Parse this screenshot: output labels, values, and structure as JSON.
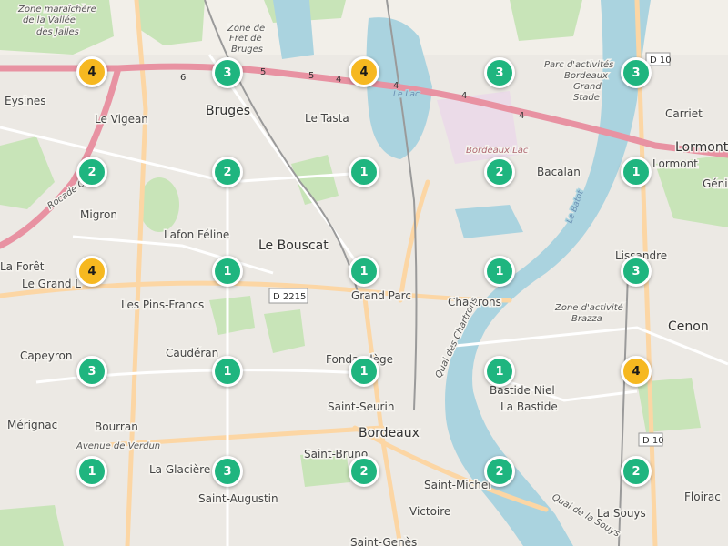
{
  "map": {
    "labels": {
      "zone_maraichere_1": "Zone maraîchère",
      "zone_maraichere_2": "de la Vallée",
      "zone_maraichere_3": "des Jalles",
      "zone_fret_1": "Zone de",
      "zone_fret_2": "Fret de",
      "zone_fret_3": "Bruges",
      "parc_1": "Parc d'activités",
      "parc_2": "Bordeaux",
      "parc_3": "Grand",
      "parc_4": "Stade",
      "eysines": "Eysines",
      "le_vigean": "Le Vigean",
      "bruges": "Bruges",
      "le_tasta": "Le Tasta",
      "le_lac": "Le Lac",
      "bordeaux_lac": "Bordeaux Lac",
      "carriet": "Carriet",
      "lormont_1": "Lormont",
      "lormont_2": "Lormont",
      "genic": "Génic",
      "bacalan": "Bacalan",
      "migron": "Migron",
      "lafon_feline": "Lafon Féline",
      "le_bouscat": "Le Bouscat",
      "la_foret": "La Forêt",
      "le_grand_lac": "Le Grand L",
      "les_pins_francs": "Les Pins-Francs",
      "grand_parc": "Grand Parc",
      "chartrons": "Chartrons",
      "lissandre": "Lissandre",
      "zone_brazza_1": "Zone d'activité",
      "zone_brazza_2": "Brazza",
      "cenon": "Cenon",
      "capeyron": "Capeyron",
      "cauderan": "Caudéran",
      "fondaudege": "Fondaudège",
      "bastide_niel": "Bastide Niel",
      "la_bastide": "La Bastide",
      "saint_seurin": "Saint-Seurin",
      "bordeaux": "Bordeaux",
      "merignac": "Mérignac",
      "bourran": "Bourran",
      "avenue_verdun": "Avenue de Verdun",
      "la_glaciere": "La Glacière",
      "saint_bruno": "Saint-Bruno",
      "saint_michel": "Saint-Michel",
      "saint_augustin": "Saint-Augustin",
      "victoire": "Victoire",
      "la_souys": "La Souys",
      "floirac": "Floirac",
      "saint_genes": "Saint-Genès",
      "quai_chartrons": "Quai des Chartrons",
      "quai_souys": "Quai de la Souys",
      "rocade": "Rocade Ouest",
      "le_batot": "Le Batot"
    },
    "shields": {
      "d2215": "D 2215",
      "d10_top": "D 10",
      "d10_bottom": "D 10",
      "r4a": "4",
      "r4b": "4",
      "r4c": "4",
      "r4d": "4",
      "r5": "5",
      "r6": "6",
      "r5b": "5"
    },
    "colors": {
      "land": "#f2efe9",
      "water": "#aad3df",
      "park": "#c8e4b8",
      "motorway": "#e892a2",
      "primary_road": "#fcd6a4",
      "cluster_small": "#1fb57f",
      "cluster_medium": "#f6b820"
    }
  },
  "clusters": [
    {
      "id": "c1",
      "count": "4",
      "level": "yellow"
    },
    {
      "id": "c2",
      "count": "3",
      "level": "green"
    },
    {
      "id": "c3",
      "count": "4",
      "level": "yellow"
    },
    {
      "id": "c4",
      "count": "3",
      "level": "green"
    },
    {
      "id": "c5",
      "count": "3",
      "level": "green"
    },
    {
      "id": "c6",
      "count": "2",
      "level": "green"
    },
    {
      "id": "c7",
      "count": "2",
      "level": "green"
    },
    {
      "id": "c8",
      "count": "1",
      "level": "green"
    },
    {
      "id": "c9",
      "count": "2",
      "level": "green"
    },
    {
      "id": "c10",
      "count": "1",
      "level": "green"
    },
    {
      "id": "c11",
      "count": "4",
      "level": "yellow"
    },
    {
      "id": "c12",
      "count": "1",
      "level": "green"
    },
    {
      "id": "c13",
      "count": "1",
      "level": "green"
    },
    {
      "id": "c14",
      "count": "1",
      "level": "green"
    },
    {
      "id": "c15",
      "count": "3",
      "level": "green"
    },
    {
      "id": "c16",
      "count": "3",
      "level": "green"
    },
    {
      "id": "c17",
      "count": "1",
      "level": "green"
    },
    {
      "id": "c18",
      "count": "1",
      "level": "green"
    },
    {
      "id": "c19",
      "count": "1",
      "level": "green"
    },
    {
      "id": "c20",
      "count": "4",
      "level": "yellow"
    },
    {
      "id": "c21",
      "count": "1",
      "level": "green"
    },
    {
      "id": "c22",
      "count": "3",
      "level": "green"
    },
    {
      "id": "c23",
      "count": "2",
      "level": "green"
    },
    {
      "id": "c24",
      "count": "2",
      "level": "green"
    },
    {
      "id": "c25",
      "count": "2",
      "level": "green"
    }
  ]
}
